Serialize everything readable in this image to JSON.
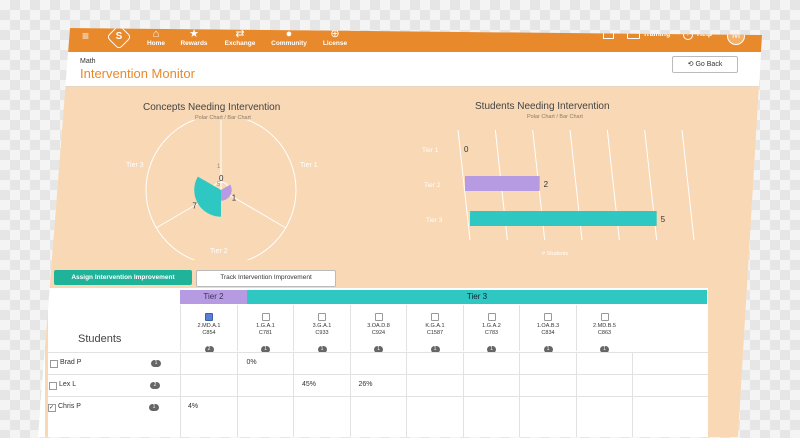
{
  "topbar": {
    "logo_letter": "S",
    "nav": [
      {
        "label": "Home",
        "icon": "home-icon",
        "glyph": "⌂"
      },
      {
        "label": "Rewards",
        "icon": "star-icon",
        "glyph": "★"
      },
      {
        "label": "Exchange",
        "icon": "exchange-icon",
        "glyph": "⇄"
      },
      {
        "label": "Community",
        "icon": "community-icon",
        "glyph": "●"
      },
      {
        "label": "License",
        "icon": "license-icon",
        "glyph": "⊕"
      }
    ],
    "training_label": "Training",
    "help_label": "Help",
    "avatar_letter": "M",
    "accent": "#e8892c"
  },
  "header": {
    "subject": "Math",
    "title": "Intervention Monitor",
    "go_back_label": "Go Back"
  },
  "charts": {
    "concepts": {
      "title": "Concepts Needing Intervention",
      "subtitle": "Polar Chart / Bar Chart",
      "tier3_label": "Tier 3",
      "tier1_label": "Tier 1",
      "tier2_label": "Tier 2",
      "ring_ticks": [
        "1",
        "5"
      ]
    },
    "students": {
      "title": "Students Needing Intervention",
      "subtitle": "Polar Chart / Bar Chart",
      "xlabel": "# Students"
    }
  },
  "chart_data": [
    {
      "type": "pie",
      "title": "Concepts Needing Intervention",
      "categories": [
        "Tier 1",
        "Tier 2",
        "Tier 3"
      ],
      "values": [
        0,
        1,
        7
      ],
      "colors": [
        "#2ec7c2",
        "#b79be2",
        "#2ec7c2"
      ]
    },
    {
      "type": "bar",
      "title": "Students Needing Intervention",
      "categories": [
        "Tier 1",
        "Tier 2",
        "Tier 3"
      ],
      "values": [
        0,
        2,
        5
      ],
      "colors": [
        "#2ec7c2",
        "#b79be2",
        "#2ec7c2"
      ],
      "xlabel": "# Students",
      "xlim": [
        0,
        6
      ]
    }
  ],
  "tabs": {
    "assign": "Assign Intervention Improvement",
    "track": "Track Intervention Improvement"
  },
  "table": {
    "tier2_header": "Tier 2",
    "tier3_header": "Tier 3",
    "students_label": "Students",
    "columns": [
      {
        "standard": "2.MD.A.1",
        "code": "C854",
        "count": "2",
        "checked": true
      },
      {
        "standard": "1.G.A.1",
        "code": "C781",
        "count": "1",
        "checked": false
      },
      {
        "standard": "3.G.A.1",
        "code": "C933",
        "count": "1",
        "checked": false
      },
      {
        "standard": "3.OA.D.8",
        "code": "C924",
        "count": "1",
        "checked": false
      },
      {
        "standard": "K.G.A.1",
        "code": "C1587",
        "count": "1",
        "checked": false
      },
      {
        "standard": "1.G.A.2",
        "code": "C783",
        "count": "1",
        "checked": false
      },
      {
        "standard": "1.OA.B.3",
        "code": "C834",
        "count": "1",
        "checked": false
      },
      {
        "standard": "2.MD.B.5",
        "code": "C863",
        "count": "1",
        "checked": false
      }
    ],
    "rows": [
      {
        "name": "Brad P",
        "count": "1",
        "checked": false,
        "cells": [
          "",
          "0%",
          "",
          "",
          "",
          "",
          "",
          ""
        ]
      },
      {
        "name": "Lex L",
        "count": "2",
        "checked": false,
        "cells": [
          "",
          "",
          "45%",
          "26%",
          "",
          "",
          "",
          ""
        ]
      },
      {
        "name": "Chris P",
        "count": "1",
        "checked": true,
        "cells": [
          "4%",
          "",
          "",
          "",
          "",
          "",
          "",
          ""
        ]
      }
    ]
  }
}
